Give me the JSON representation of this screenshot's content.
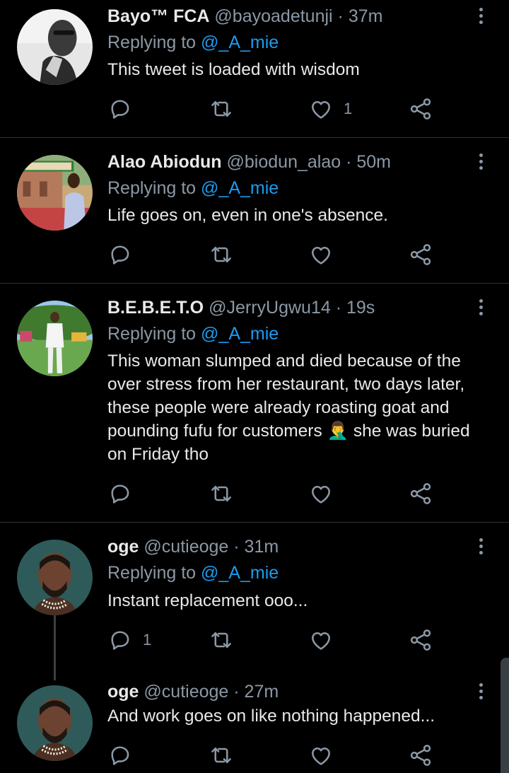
{
  "tweets": [
    {
      "name": "Bayo™ FCA",
      "handle": "@bayoadetunji",
      "time": "· 37m",
      "replying_prefix": "Replying to ",
      "replying_to": "@_A_mie",
      "text": "This tweet is loaded with wisdom",
      "reply_count": "",
      "retweet_count": "",
      "like_count": "1"
    },
    {
      "name": "Alao Abiodun",
      "handle": "@biodun_alao",
      "time": "· 50m",
      "replying_prefix": "Replying to ",
      "replying_to": "@_A_mie",
      "text": "Life goes on, even in one's absence.",
      "reply_count": "",
      "retweet_count": "",
      "like_count": ""
    },
    {
      "name": "B.E.B.E.T.O",
      "handle": "@JerryUgwu14",
      "time": "· 19s",
      "replying_prefix": "Replying to ",
      "replying_to": "@_A_mie",
      "text_before_emoji": "This woman slumped and died because of the over stress from her restaurant, two days later, these people were already roasting goat and pounding fufu for customers ",
      "emoji": "🤦‍♂️",
      "text_after_emoji": " she was buried on Friday tho",
      "reply_count": "",
      "retweet_count": "",
      "like_count": ""
    },
    {
      "name": "oge",
      "handle": "@cutieoge",
      "time": "· 31m",
      "replying_prefix": "Replying to ",
      "replying_to": "@_A_mie",
      "text": "Instant replacement ooo...",
      "reply_count": "1",
      "retweet_count": "",
      "like_count": ""
    },
    {
      "name": "oge",
      "handle": "@cutieoge",
      "time": "· 27m",
      "text": "And work goes on like nothing happened...",
      "reply_count": "",
      "retweet_count": "",
      "like_count": ""
    }
  ],
  "icons": {
    "reply": "reply-icon",
    "retweet": "retweet-icon",
    "like": "heart-icon",
    "share": "share-icon",
    "more": "more-vertical-icon"
  },
  "colors": {
    "background": "#000000",
    "text": "#e7e9ea",
    "muted": "#8b98a5",
    "mention": "#1d9bf0",
    "divider": "#2f3336"
  }
}
